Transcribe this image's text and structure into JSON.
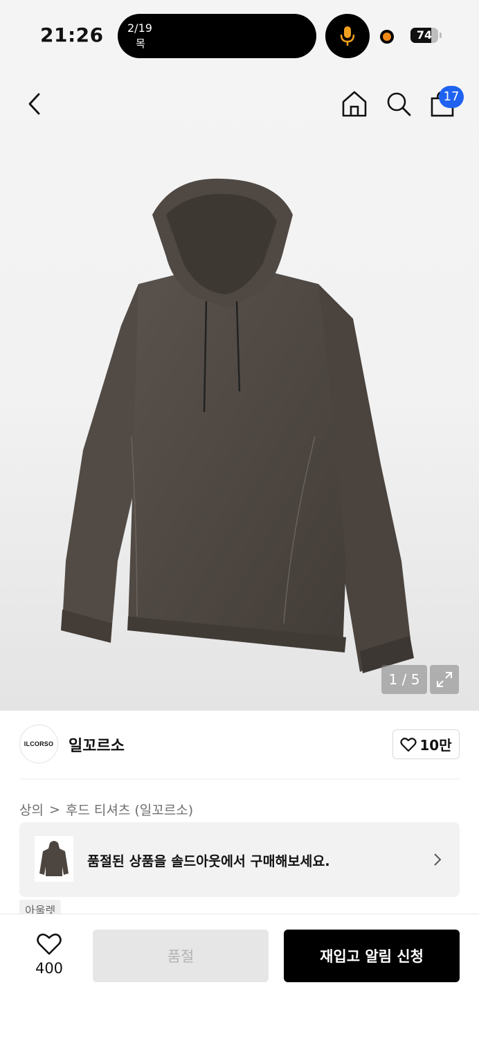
{
  "status_bar": {
    "time": "21:26",
    "island_date": "2/19",
    "island_day": "목",
    "battery_level": 74,
    "battery_text": "74",
    "mic_color": "#f0a020",
    "rec_color": "#f08a18"
  },
  "nav": {
    "back_icon": "chevron-left-icon",
    "home_icon": "home-icon",
    "search_icon": "search-icon",
    "cart_icon": "shopping-bag-icon",
    "cart_count": "17",
    "badge_color": "#1f62f0"
  },
  "gallery": {
    "counter": "1 / 5",
    "expand_icon": "expand-icon"
  },
  "brand": {
    "logo_text": "ILCORSO",
    "name": "일꼬르소",
    "like_icon": "heart-outline-icon",
    "likes": "10만"
  },
  "breadcrumb": {
    "category": "상의",
    "separator": ">",
    "subcategory": "후드 티셔츠 (일꼬르소)"
  },
  "soldout_banner": {
    "text": "품절된 상품을 솔드아웃에서 구매해보세요."
  },
  "tag": {
    "label": "아울렛"
  },
  "bottom_bar": {
    "wish_count": "400",
    "soldout_label": "품절",
    "restock_label": "재입고 알림 신청"
  }
}
